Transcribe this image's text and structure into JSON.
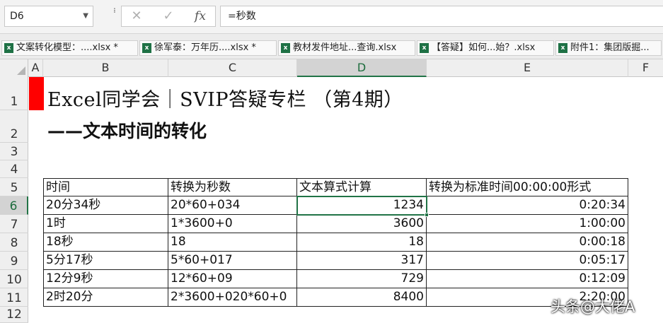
{
  "formula_bar": {
    "name_box": "D6",
    "cancel_icon": "✕",
    "enter_icon": "✓",
    "fx_label": "fx",
    "formula": "=秒数"
  },
  "workbook_tabs": [
    {
      "label": "文案转化模型：....xlsx *"
    },
    {
      "label": "徐军泰：万年历....xlsx *"
    },
    {
      "label": "教材发件地址...查询.xlsx"
    },
    {
      "label": "【答疑】如何...始？.xlsx"
    },
    {
      "label": "附件1：集团版掘..."
    }
  ],
  "columns": [
    "A",
    "B",
    "C",
    "D",
    "E",
    "F"
  ],
  "rows": [
    "1",
    "2",
    "3",
    "4",
    "5",
    "6",
    "7",
    "8",
    "9",
    "10",
    "11",
    "12"
  ],
  "active_cell": {
    "column": "D",
    "row": "6"
  },
  "sheet": {
    "title_line1": "Excel同学会｜SVIP答疑专栏 （第4期）",
    "title_line2": "——文本时间的转化",
    "table_headers": [
      "时间",
      "转换为秒数",
      "文本算式计算",
      "转换为标准时间00:00:00形式"
    ],
    "table_rows": [
      [
        "20分34秒",
        "20*60+034",
        "1234",
        "0:20:34"
      ],
      [
        "1时",
        "1*3600+0",
        "3600",
        "1:00:00"
      ],
      [
        "18秒",
        "18",
        "18",
        "0:00:18"
      ],
      [
        "5分17秒",
        "5*60+017",
        "317",
        "0:05:17"
      ],
      [
        "12分9秒",
        "12*60+09",
        "729",
        "0:12:09"
      ],
      [
        "2时20分",
        "2*3600+020*60+0",
        "8400",
        "2:20:00"
      ]
    ]
  },
  "watermark": "头条@大佬A",
  "colors": {
    "accent": "#217346",
    "marker": "#ff0000"
  }
}
